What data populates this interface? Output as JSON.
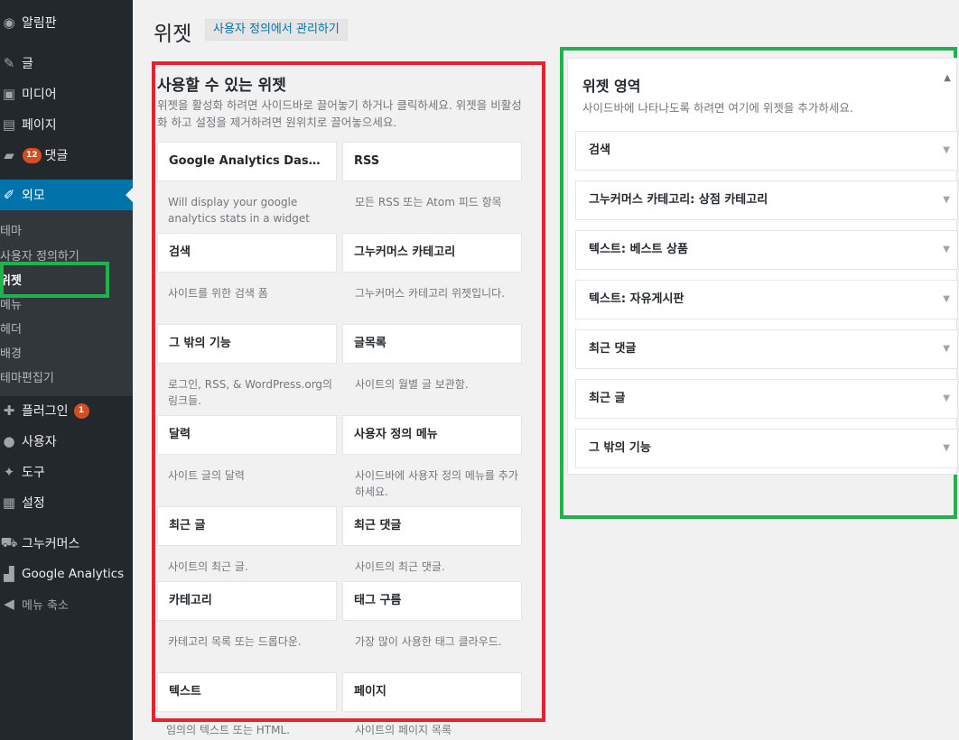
{
  "sidebar": {
    "items": [
      {
        "label": "알림판",
        "icon": "dashboard-icon",
        "glyph": "◉"
      },
      {
        "label": "글",
        "icon": "pin-icon",
        "glyph": "✎"
      },
      {
        "label": "미디어",
        "icon": "media-icon",
        "glyph": "▣"
      },
      {
        "label": "페이지",
        "icon": "page-icon",
        "glyph": "▤"
      },
      {
        "label": "댓글",
        "icon": "comment-icon",
        "glyph": "▰",
        "badge": "12"
      },
      {
        "label": "외모",
        "icon": "appearance-icon",
        "glyph": "✐"
      },
      {
        "label": "플러그인",
        "icon": "plugin-icon",
        "glyph": "✚",
        "badge": "1"
      },
      {
        "label": "사용자",
        "icon": "users-icon",
        "glyph": "●"
      },
      {
        "label": "도구",
        "icon": "tools-icon",
        "glyph": "✦"
      },
      {
        "label": "설정",
        "icon": "settings-icon",
        "glyph": "▦"
      },
      {
        "label": "그누커머스",
        "icon": "cart-icon",
        "glyph": "⛟"
      },
      {
        "label": "Google Analytics",
        "icon": "analytics-icon",
        "glyph": "▟"
      },
      {
        "label": "메뉴 축소",
        "icon": "collapse-icon",
        "glyph": "◀"
      }
    ],
    "submenu": [
      "테마",
      "사용자 정의하기",
      "위젯",
      "메뉴",
      "헤더",
      "배경",
      "테마편집기"
    ]
  },
  "header": {
    "title": "위젯",
    "manage_button": "사용자 정의에서 관리하기"
  },
  "available": {
    "title": "사용할 수 있는 위젯",
    "description": "위젯을 활성화 하려면 사이드바로 끌어놓기 하거나 클릭하세요. 위젯을 비활성화 하고 설정을 제거하려면 원위치로 끌어놓으세요.",
    "widgets": [
      {
        "name": "Google Analytics Dashbo...",
        "desc": "Will display your google analytics stats in a widget"
      },
      {
        "name": "RSS",
        "desc": "모든 RSS 또는 Atom 피드 항목"
      },
      {
        "name": "검색",
        "desc": "사이트를 위한 검색 폼"
      },
      {
        "name": "그누커머스 카테고리",
        "desc": "그누커머스 카테고리 위젯입니다."
      },
      {
        "name": "그 밖의 기능",
        "desc": "로그인, RSS, & WordPress.org의 링크들."
      },
      {
        "name": "글목록",
        "desc": "사이트의 월별 글 보관함."
      },
      {
        "name": "달력",
        "desc": "사이트 글의 달력"
      },
      {
        "name": "사용자 정의 메뉴",
        "desc": "사이드바에 사용자 정의 메뉴를 추가하세요."
      },
      {
        "name": "최근 글",
        "desc": "사이트의 최근 글."
      },
      {
        "name": "최근 댓글",
        "desc": "사이트의 최근 댓글."
      },
      {
        "name": "카테고리",
        "desc": "카테고리 목록 또는 드롭다운."
      },
      {
        "name": "태그 구름",
        "desc": "가장 많이 사용한 태그 클라우드."
      },
      {
        "name": "텍스트",
        "desc": "임의의 텍스트 또는 HTML."
      },
      {
        "name": "페이지",
        "desc": "사이트의 페이지 목록"
      }
    ]
  },
  "area": {
    "title": "위젯 영역",
    "description": "사이드바에 나타나도록 하려면 여기에 위젯을 추가하세요.",
    "widgets": [
      "검색",
      "그누커머스 카테고리: 상점 카테고리",
      "텍스트: 베스트 상품",
      "텍스트: 자유게시판",
      "최근 댓글",
      "최근 글",
      "그 밖의 기능"
    ]
  }
}
